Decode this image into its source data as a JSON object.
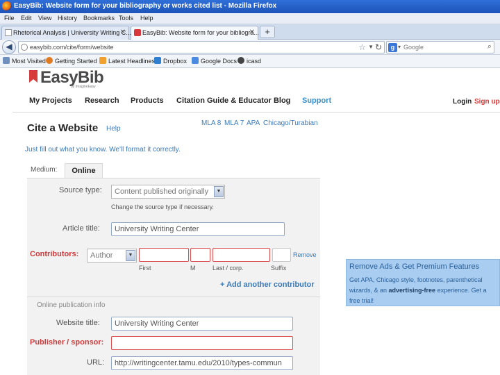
{
  "browser": {
    "window_title": "EasyBib: Website form for your bibliography or works cited list - Mozilla Firefox",
    "menu": [
      "File",
      "Edit",
      "View",
      "History",
      "Bookmarks",
      "Tools",
      "Help"
    ],
    "tabs": [
      {
        "label": "Rhetorical Analysis | University Writing C...",
        "active": false
      },
      {
        "label": "EasyBib: Website form for your bibliogra...",
        "active": true
      }
    ],
    "url": "easybib.com/cite/form/website",
    "search_engine": "Google",
    "search_placeholder": "Google",
    "bookmarks": [
      "Most Visited",
      "Getting Started",
      "Latest Headlines",
      "Dropbox",
      "Google Docs",
      "icasd"
    ]
  },
  "site": {
    "logo_text": "EasyBib",
    "logo_sub": "by ImagineEasy",
    "nav": [
      "My Projects",
      "Research",
      "Products",
      "Citation Guide & Educator Blog",
      "Support"
    ],
    "login": "Login",
    "signup": "Sign up"
  },
  "page": {
    "title": "Cite a Website",
    "help": "Help",
    "styles": [
      "MLA 8",
      "MLA 7",
      "APA",
      "Chicago/Turabian"
    ],
    "tagline": "Just fill out what you know. We'll format it correctly.",
    "medium_label": "Medium:",
    "medium_tab": "Online"
  },
  "form": {
    "source_type_label": "Source type:",
    "source_type_value": "Content published originally",
    "source_type_hint": "Change the source type if necessary.",
    "article_title_label": "Article title:",
    "article_title_value": "University Writing Center",
    "contributors_label": "Contributors:",
    "contributor_role": "Author",
    "contributor_first": "",
    "contributor_middle": "",
    "contributor_last": "",
    "contributor_suffix": "",
    "sub_first": "First",
    "sub_middle": "M",
    "sub_last": "Last / corp.",
    "sub_suffix": "Suffix",
    "remove": "Remove",
    "add_contributor": "+ Add another contributor",
    "online_info": "Online publication info",
    "website_title_label": "Website title:",
    "website_title_value": "University Writing Center",
    "publisher_label": "Publisher / sponsor:",
    "publisher_value": "",
    "url_label": "URL:",
    "url_value": "http://writingcenter.tamu.edu/2010/types-commun"
  },
  "promo": {
    "heading": "Remove Ads & Get Premium Features",
    "text_pre": "Get APA, Chicago style, footnotes, parenthetical wizards, & an ",
    "text_bold": "advertising-free",
    "text_post": " experience. Get a free trial!"
  },
  "colors": {
    "accent_red": "#cc3b3b",
    "link_blue": "#3a7ab8",
    "promo_bg": "#a8cdf0"
  }
}
